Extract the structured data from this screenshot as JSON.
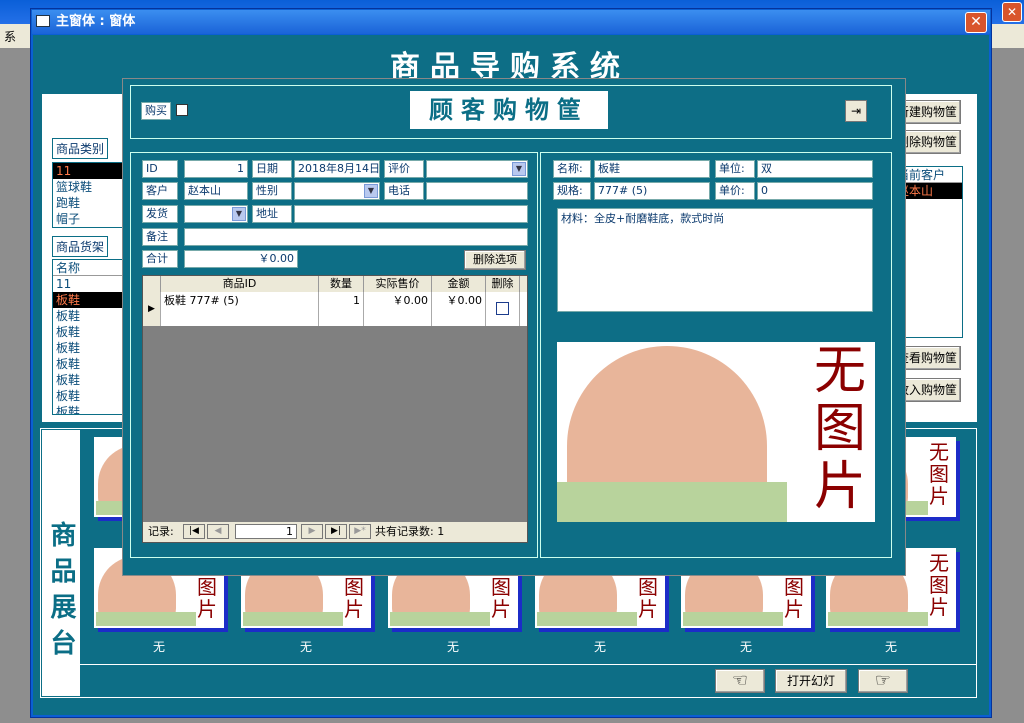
{
  "outer_window": {
    "title": "",
    "menu_first": "系",
    "close": "✕"
  },
  "window": {
    "title": "主窗体 : 窗体",
    "close": "✕"
  },
  "system_title": "商品导购系统",
  "left_panel": {
    "category_label": "商品类别",
    "categories": [
      "11",
      "篮球鞋",
      "跑鞋",
      "帽子"
    ],
    "category_selected_index": 0,
    "shelf_label": "商品货架",
    "shelf_header": "名称",
    "shelf_items": [
      "11",
      "板鞋",
      "板鞋",
      "板鞋",
      "板鞋",
      "板鞋",
      "板鞋",
      "板鞋",
      "板鞋"
    ],
    "shelf_selected_index": 1
  },
  "right_panel": {
    "btn_new_cart": "新建购物筐",
    "btn_del_cart": "删除购物筐",
    "current_customer_header": "当前客户",
    "current_customer": "赵本山",
    "btn_view_cart": "查看购物筐",
    "btn_add_cart": "放入购物筐"
  },
  "cart_dialog": {
    "buy_label": "购买",
    "title": "顾客购物筐",
    "id_label": "ID",
    "id_value": "1",
    "date_label": "日期",
    "date_value": "2018年8月14日",
    "rating_label": "评价",
    "rating_value": "",
    "customer_label": "客户",
    "customer_value": "赵本山",
    "gender_label": "性别",
    "gender_value": "",
    "phone_label": "电话",
    "phone_value": "",
    "ship_label": "发货",
    "ship_value": "",
    "address_label": "地址",
    "address_value": "",
    "note_label": "备注",
    "note_value": "",
    "total_label": "合计",
    "total_value": "￥0.00",
    "delete_btn": "删除选项",
    "grid_headers": [
      "商品ID",
      "数量",
      "实际售价",
      "金额",
      "删除"
    ],
    "grid_rows": [
      {
        "product": "板鞋 777# (5)",
        "qty": "1",
        "price": "￥0.00",
        "amount": "￥0.00",
        "delete": false
      }
    ],
    "nav_label": "记录:",
    "nav_current": "1",
    "nav_total_label": "共有记录数: 1"
  },
  "product_detail": {
    "name_label": "名称:",
    "name_value": "板鞋",
    "unit_label": "单位:",
    "unit_value": "双",
    "spec_label": "规格:",
    "spec_value": "777# (5)",
    "price_label": "单价:",
    "price_value": "0",
    "desc": "材料：全皮+耐磨鞋底，款式时尚",
    "no_image_text": "无图片"
  },
  "showcase": {
    "label": "商品展台",
    "thumb_text": "图片",
    "thumb_text_full": "无图片",
    "captions": [
      "无",
      "无",
      "无",
      "无",
      "无",
      "无"
    ]
  },
  "bottom": {
    "prev_icon": "☜",
    "slideshow": "打开幻灯",
    "next_icon": "☞"
  }
}
